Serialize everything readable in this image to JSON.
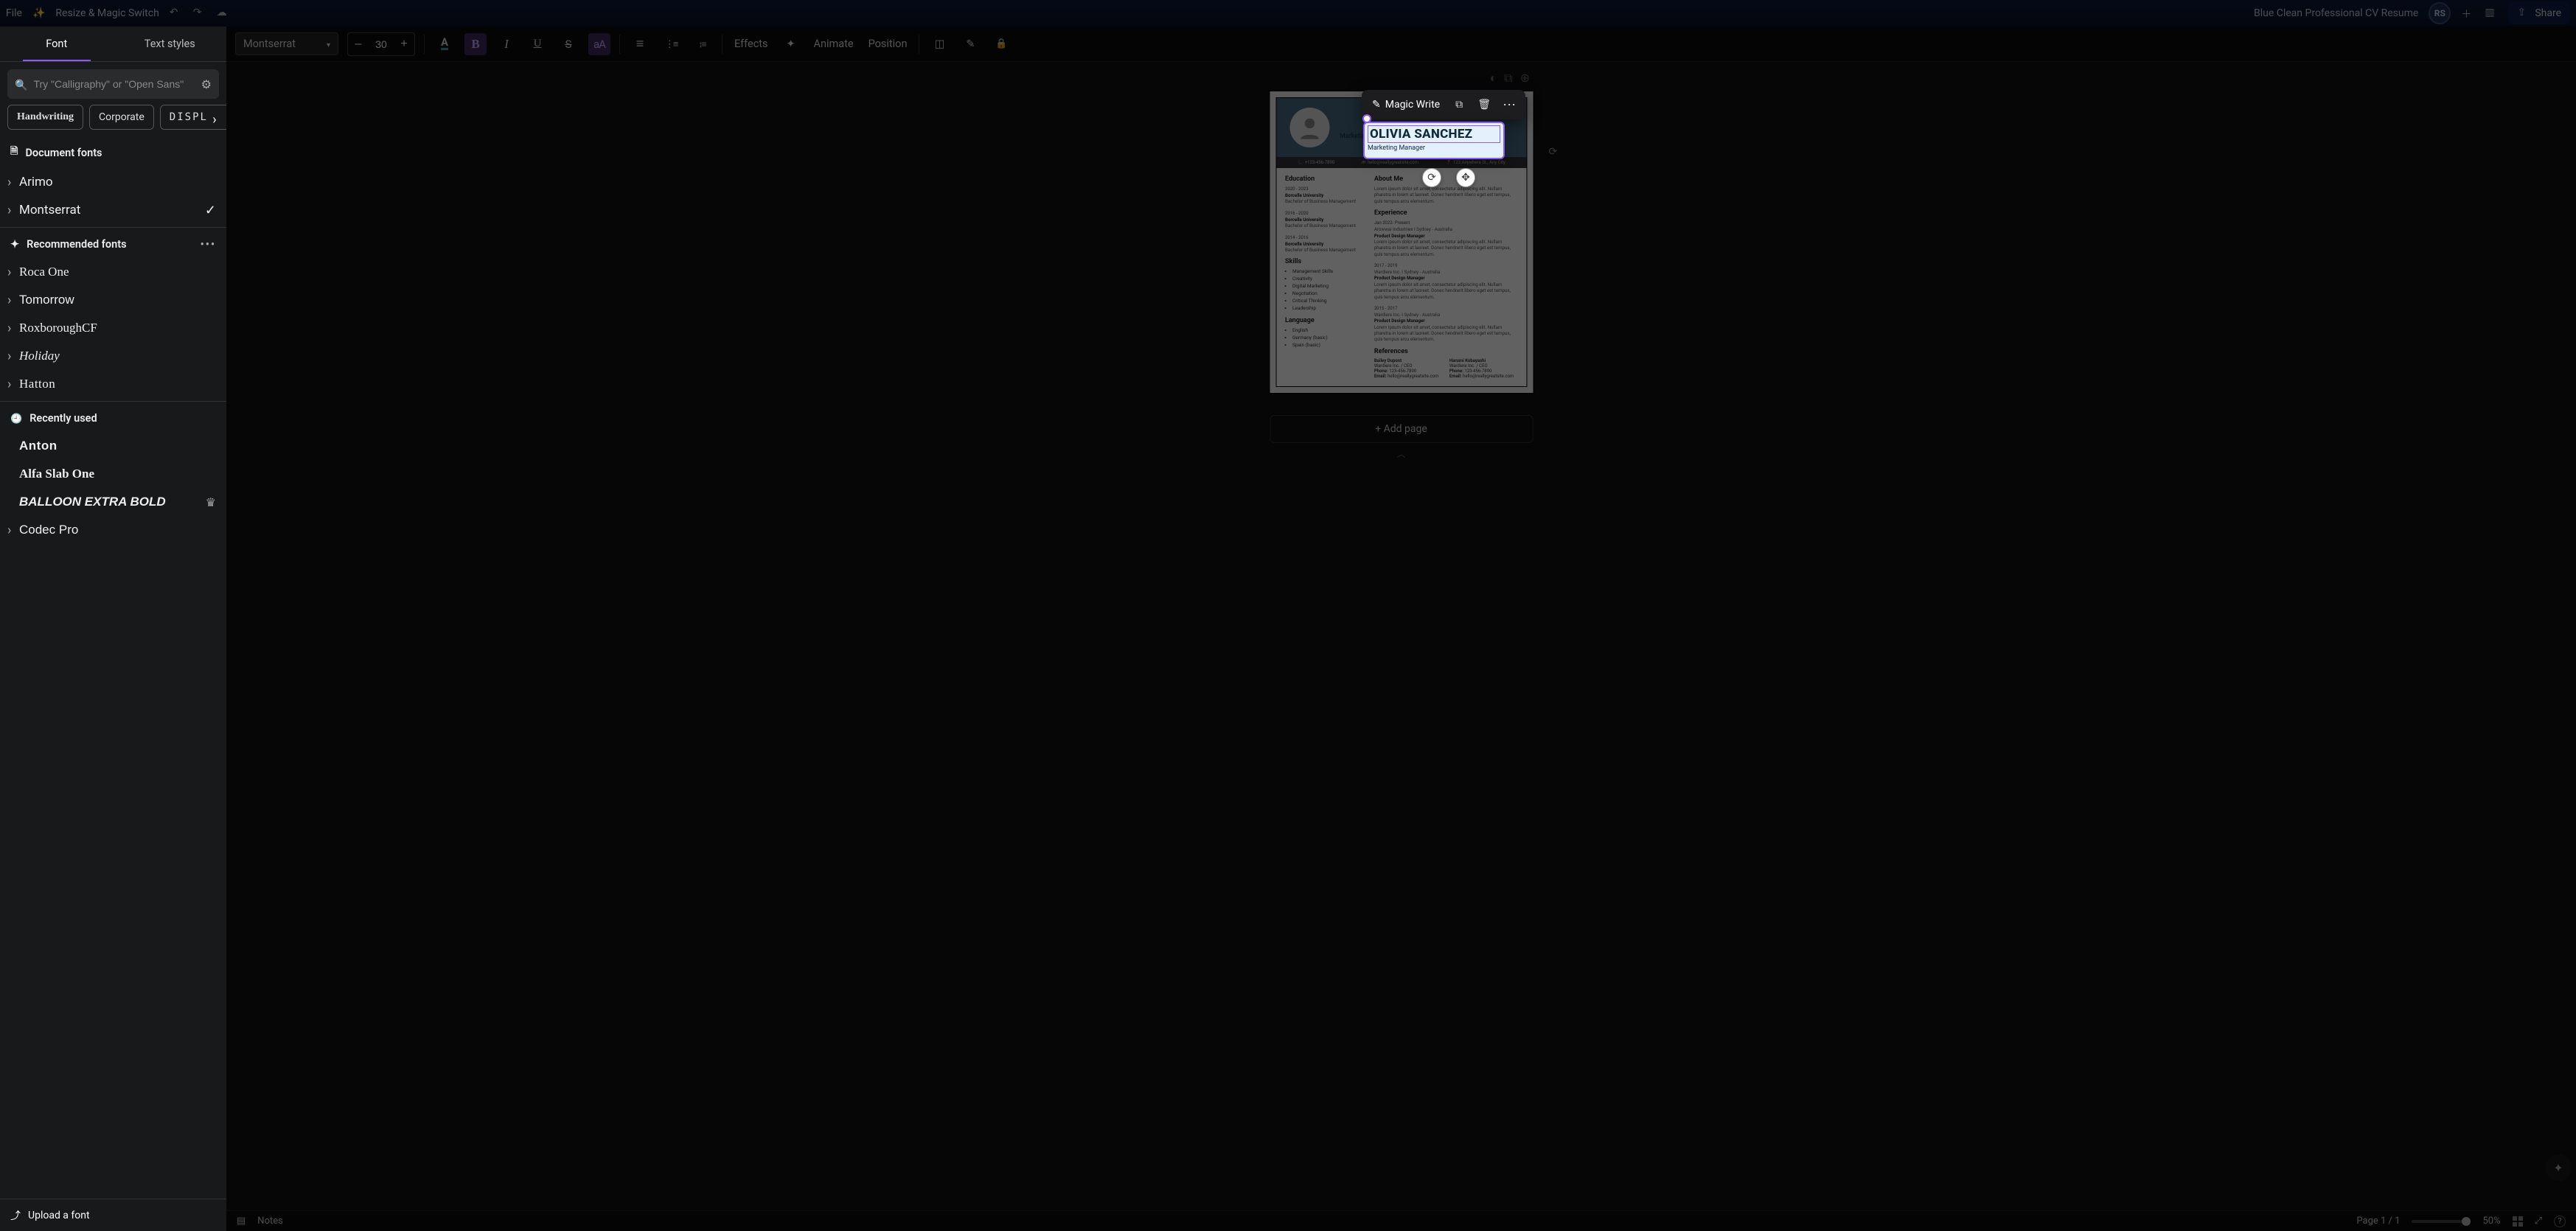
{
  "topbar": {
    "file_menu": "File",
    "resize": "Resize & Magic Switch",
    "doc_title": "Blue Clean Professional CV Resume",
    "initials": "RS",
    "share": "Share"
  },
  "toolbar": {
    "font": "Montserrat",
    "size": "30",
    "effects": "Effects",
    "animate": "Animate",
    "position": "Position",
    "bold": "B",
    "italic": "I",
    "underline": "U",
    "strike": "S",
    "case": "aA"
  },
  "leftpanel": {
    "tab_font": "Font",
    "tab_styles": "Text styles",
    "search_placeholder": "Try \"Calligraphy\" or \"Open Sans\"",
    "chips": {
      "handwriting": "Handwriting",
      "corporate": "Corporate",
      "display": "DISPLAY"
    },
    "doc_fonts_header": "Document fonts",
    "doc_fonts": [
      {
        "name": "Arimo",
        "cls": "",
        "checked": false
      },
      {
        "name": "Montserrat",
        "cls": "",
        "checked": true
      }
    ],
    "rec_header": "Recommended fonts",
    "rec_fonts": [
      {
        "name": "Roca One",
        "cls": "f-roca"
      },
      {
        "name": "Tomorrow",
        "cls": "f-tomorrow"
      },
      {
        "name": "RoxboroughCF",
        "cls": "f-rox"
      },
      {
        "name": "Holiday",
        "cls": "f-holiday"
      },
      {
        "name": "Hatton",
        "cls": "f-hatton"
      }
    ],
    "recent_header": "Recently used",
    "recent_fonts": [
      {
        "name": "Anton",
        "cls": "f-anton",
        "exp": false
      },
      {
        "name": "Alfa Slab One",
        "cls": "f-alfa",
        "exp": false
      },
      {
        "name": "BALLOON EXTRA BOLD",
        "cls": "f-balloon",
        "exp": false,
        "crown": true
      },
      {
        "name": "Codec Pro",
        "cls": "f-codec",
        "exp": true
      }
    ],
    "upload": "Upload a font"
  },
  "context": {
    "magic_write": "Magic Write"
  },
  "resume": {
    "name": "OLIVIA SANCHEZ",
    "role": "Marketing Manager",
    "contact": {
      "phone": "+123-456-7890",
      "email": "hello@reallygreatsite.com",
      "addr": "123 Anywhere St., Any City"
    },
    "education_h": "Education",
    "education": [
      {
        "date": "2020 - 2023",
        "uni": "Borcelle University",
        "deg": "Bachelor of Business Management"
      },
      {
        "date": "2016 - 2020",
        "uni": "Borcelle University",
        "deg": "Bachelor of Business Management"
      },
      {
        "date": "2014 - 2016",
        "uni": "Borcelle University",
        "deg": "Bachelor of Business Management"
      }
    ],
    "skills_h": "Skills",
    "skills": [
      "Management Skills",
      "Creativity",
      "Digital Marketing",
      "Negotiation",
      "Critical Thinking",
      "Leadership"
    ],
    "language_h": "Language",
    "languages": [
      "English",
      "Germany (basic)",
      "Spain (basic)"
    ],
    "about_h": "About Me",
    "about_body": "Lorem ipsum dolor sit amet, consectetur adipiscing elit. Nullam pharetra in lorem at laoreet. Donec hendrerit libero eget est tempus, quis tempus arcu elementum.",
    "exp_h": "Experience",
    "experience": [
      {
        "date": "Jan 2022- Present",
        "co": "Arowwai Industries I Sydney - Australia",
        "title": "Product Design Manager",
        "body": "Lorem ipsum dolor sit amet, consectetur adipiscing elit. Nullam pharetra in lorem at laoreet. Donec hendrerit libero eget est tempus, quis tempus arcu elementum."
      },
      {
        "date": "2017 - 2019",
        "co": "Wardiere Inc. I Sydney - Australia",
        "title": "Product Design Manager",
        "body": "Lorem ipsum dolor sit amet, consectetur adipiscing elit. Nullam pharetra in lorem at laoreet. Donec hendrerit libero eget est tempus, quis tempus arcu elementum."
      },
      {
        "date": "2015 - 2017",
        "co": "Wardiere Inc. I Sydney - Australia",
        "title": "Product Design Manager",
        "body": "Lorem ipsum dolor sit amet, consectetur adipiscing elit. Nullam pharetra in lorem at laoreet. Donec hendrerit libero eget est tempus, quis tempus arcu elementum."
      }
    ],
    "ref_h": "References",
    "refs": [
      {
        "name": "Bailey Dupont",
        "co": "Wardiere Inc. / CEO",
        "phone_l": "Phone:",
        "phone": "123-456-7890",
        "email_l": "Email:",
        "email": "hello@reallygreatsite.com"
      },
      {
        "name": "Harumi Kobayashi",
        "co": "Wardiere Inc. / CEO",
        "phone_l": "Phone:",
        "phone": "123-456-7890",
        "email_l": "Email:",
        "email": "hello@reallygreatsite.com"
      }
    ]
  },
  "canvas": {
    "add_page": "+ Add page"
  },
  "bottom": {
    "notes": "Notes",
    "page_indicator": "Page 1 / 1",
    "zoom": "50%"
  }
}
